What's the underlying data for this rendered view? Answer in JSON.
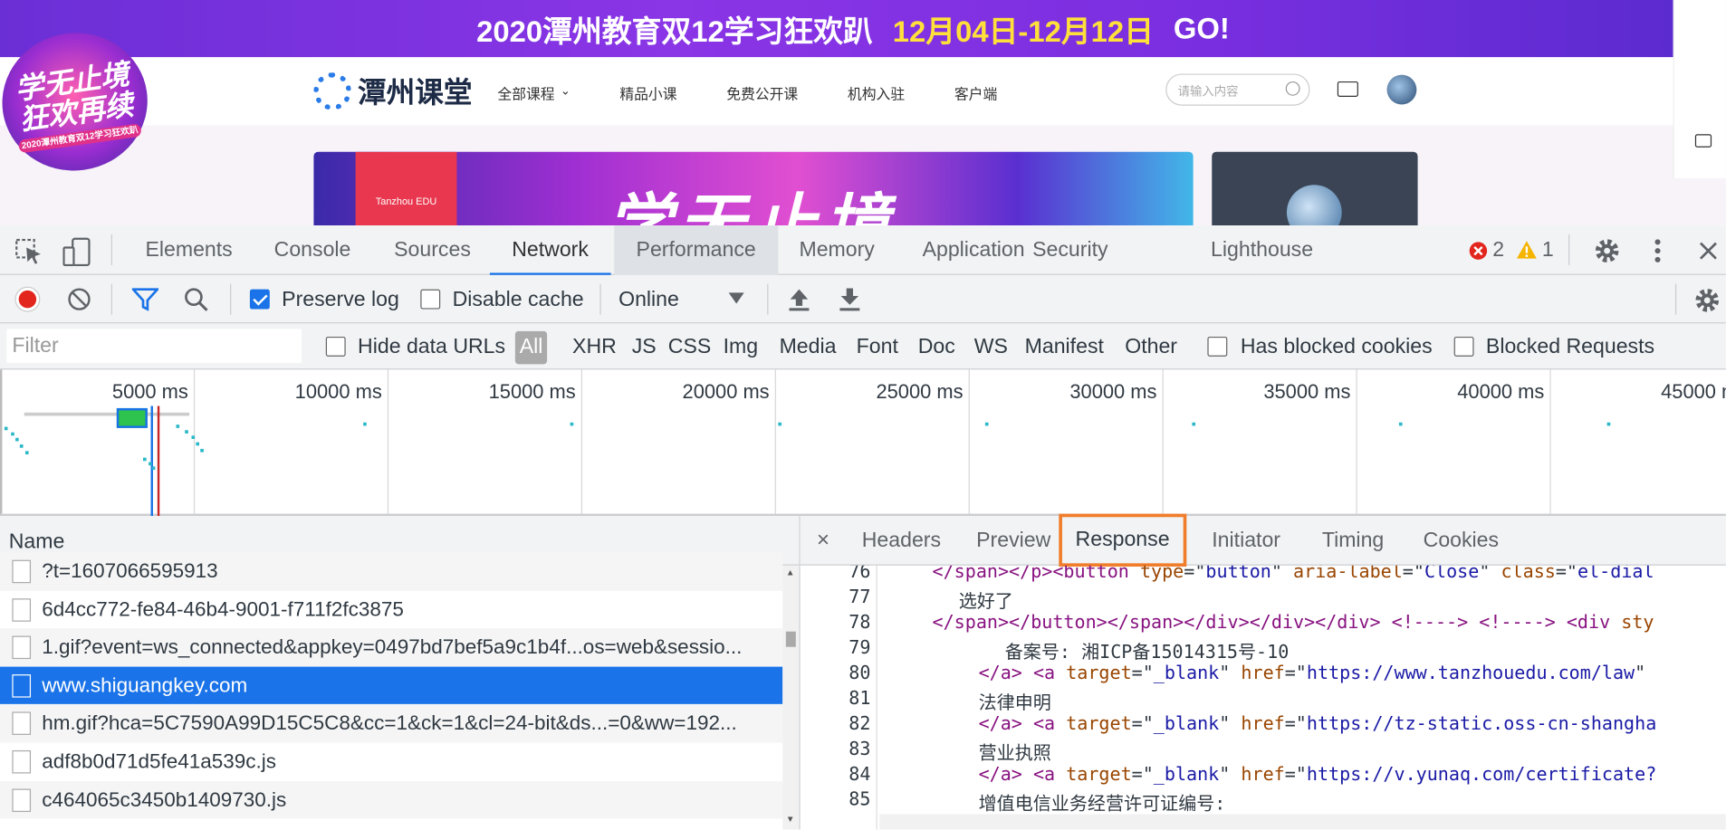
{
  "site": {
    "banner_prefix": "2020潭州教育双12学习狂欢趴",
    "banner_dates": "12月04日-12月12日",
    "banner_go": "GO!",
    "badge_title": "学无止境 狂欢再续",
    "badge_sub": "2020潭州教育双12学习狂欢趴",
    "logo_text": "潭州课堂",
    "nav": [
      "全部课程",
      "精品小课",
      "免费公开课",
      "机构入驻",
      "客户端"
    ],
    "search_placeholder": "请输入内容",
    "hero_brand": "Tanzhou EDU",
    "hero_big": "学无止境"
  },
  "devtools": {
    "tabs": [
      "Elements",
      "Console",
      "Sources",
      "Network",
      "Performance",
      "Memory",
      "Application",
      "Security",
      "Lighthouse"
    ],
    "active_tab": "Network",
    "error_count": "2",
    "warning_count": "1",
    "toolbar": {
      "preserve_log_label": "Preserve log",
      "preserve_log_checked": true,
      "disable_cache_label": "Disable cache",
      "disable_cache_checked": false,
      "throttling": "Online"
    },
    "filter": {
      "placeholder": "Filter",
      "hide_data_urls": "Hide data URLs",
      "types": [
        "All",
        "XHR",
        "JS",
        "CSS",
        "Img",
        "Media",
        "Font",
        "Doc",
        "WS",
        "Manifest",
        "Other"
      ],
      "selected_type": "All",
      "has_blocked_cookies": "Has blocked cookies",
      "blocked_requests": "Blocked Requests"
    },
    "timeline_ticks": [
      "5000 ms",
      "10000 ms",
      "15000 ms",
      "20000 ms",
      "25000 ms",
      "30000 ms",
      "35000 ms",
      "40000 ms",
      "45000 m"
    ],
    "requests": {
      "header": "Name",
      "rows": [
        {
          "name": "?t=1607066595913",
          "selected": false
        },
        {
          "name": "6d4cc772-fe84-46b4-9001-f711f2fc3875",
          "selected": false
        },
        {
          "name": "1.gif?event=ws_connected&appkey=0497bd7bef5a9c1b4f...os=web&sessio...",
          "selected": false
        },
        {
          "name": "www.shiguangkey.com",
          "selected": true
        },
        {
          "name": "hm.gif?hca=5C7590A99D15C5C8&cc=1&ck=1&cl=24-bit&ds...=0&ww=192...",
          "selected": false
        },
        {
          "name": "adf8b0d71d5fe41a539c.js",
          "selected": false
        },
        {
          "name": "c464065c3450b1409730.js",
          "selected": false
        }
      ]
    },
    "detail": {
      "close": "×",
      "tabs": [
        "Headers",
        "Preview",
        "Response",
        "Initiator",
        "Timing",
        "Cookies"
      ],
      "active_tab": "Response",
      "lines": [
        {
          "n": "76",
          "parts": [
            [
              "tg",
              "</span></p><button "
            ],
            [
              "at",
              "type"
            ],
            [
              "tx",
              "=\""
            ],
            [
              "av",
              "button"
            ],
            [
              "tx",
              "\" "
            ],
            [
              "at",
              "aria-label"
            ],
            [
              "tx",
              "=\""
            ],
            [
              "av",
              "Close"
            ],
            [
              "tx",
              "\" "
            ],
            [
              "at",
              "class"
            ],
            [
              "tx",
              "=\""
            ],
            [
              "av",
              "el-dial"
            ]
          ],
          "indent": 0
        },
        {
          "n": "77",
          "parts": [
            [
              "tx",
              "选好了"
            ]
          ],
          "indent": 1
        },
        {
          "n": "78",
          "parts": [
            [
              "tg",
              "</span></button></span></div></div></div> <!----> <!----> <div "
            ],
            [
              "at",
              "sty"
            ]
          ],
          "indent": 0
        },
        {
          "n": "79",
          "parts": [
            [
              "tx",
              "备案号: 湘ICP备15014315号-10"
            ]
          ],
          "indent": 2
        },
        {
          "n": "80",
          "parts": [
            [
              "tg",
              "</a> <a "
            ],
            [
              "at",
              "target"
            ],
            [
              "tx",
              "=\""
            ],
            [
              "av",
              "_blank"
            ],
            [
              "tx",
              "\" "
            ],
            [
              "at",
              "href"
            ],
            [
              "tx",
              "=\""
            ],
            [
              "av",
              "https://www.tanzhouedu.com/law"
            ],
            [
              "tx",
              "\""
            ]
          ],
          "indent": 3
        },
        {
          "n": "81",
          "parts": [
            [
              "tx",
              "法律申明"
            ]
          ],
          "indent": 4
        },
        {
          "n": "82",
          "parts": [
            [
              "tg",
              "</a> <a "
            ],
            [
              "at",
              "target"
            ],
            [
              "tx",
              "=\""
            ],
            [
              "av",
              "_blank"
            ],
            [
              "tx",
              "\" "
            ],
            [
              "at",
              "href"
            ],
            [
              "tx",
              "=\""
            ],
            [
              "av",
              "https://tz-static.oss-cn-shangha"
            ]
          ],
          "indent": 3
        },
        {
          "n": "83",
          "parts": [
            [
              "tx",
              "营业执照"
            ]
          ],
          "indent": 4
        },
        {
          "n": "84",
          "parts": [
            [
              "tg",
              "</a> <a "
            ],
            [
              "at",
              "target"
            ],
            [
              "tx",
              "=\""
            ],
            [
              "av",
              "_blank"
            ],
            [
              "tx",
              "\" "
            ],
            [
              "at",
              "href"
            ],
            [
              "tx",
              "=\""
            ],
            [
              "av",
              "https://v.yunaq.com/certificate?"
            ]
          ],
          "indent": 3
        },
        {
          "n": "85",
          "parts": [
            [
              "tx",
              "增值电信业务经营许可证编号:"
            ]
          ],
          "indent": 4
        }
      ]
    }
  },
  "colors": {
    "accent": "#1a73e8",
    "highlight_box": "#f07d2b",
    "record": "#e3261d"
  }
}
